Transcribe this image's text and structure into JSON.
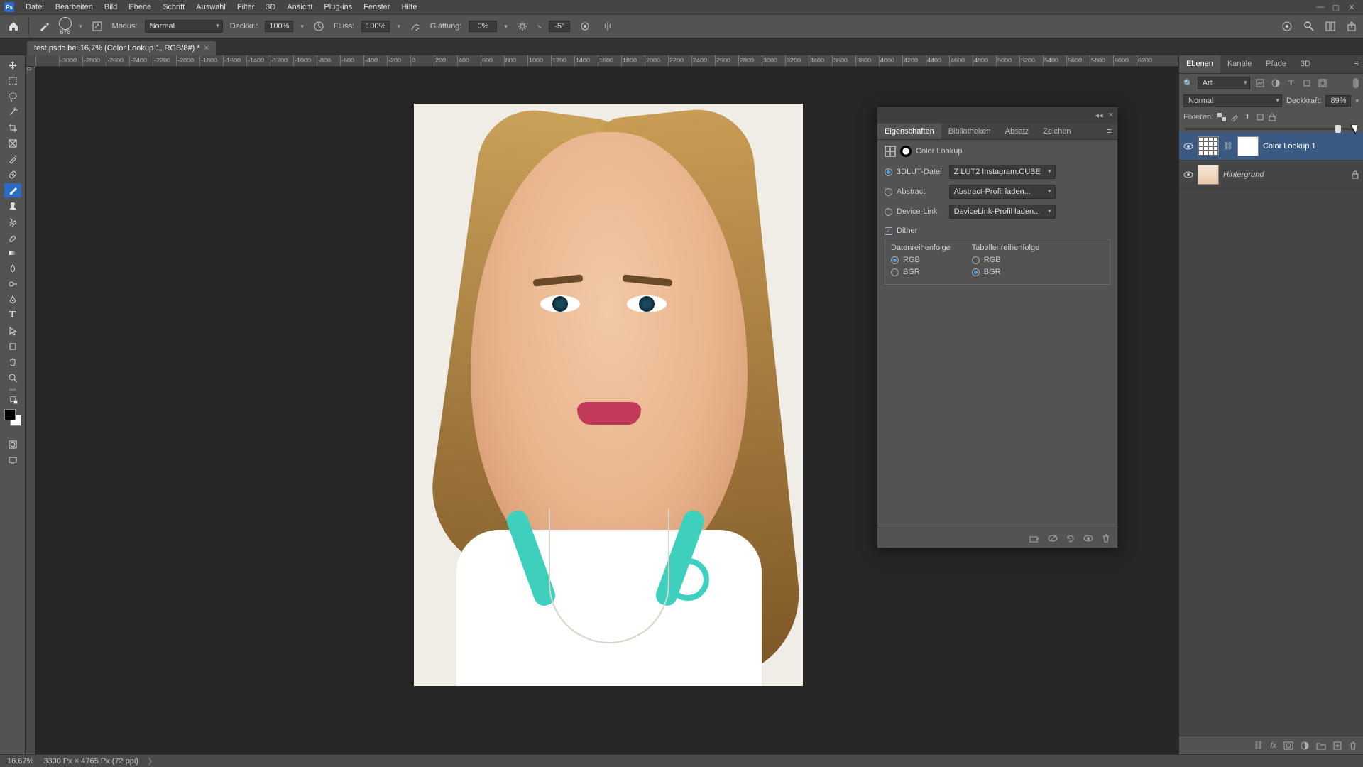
{
  "menu": {
    "items": [
      "Datei",
      "Bearbeiten",
      "Bild",
      "Ebene",
      "Schrift",
      "Auswahl",
      "Filter",
      "3D",
      "Ansicht",
      "Plug-ins",
      "Fenster",
      "Hilfe"
    ]
  },
  "options": {
    "brush_size": "678",
    "modus_label": "Modus:",
    "modus_value": "Normal",
    "deckkr_label": "Deckkr.:",
    "deckkr_value": "100%",
    "fluss_label": "Fluss:",
    "fluss_value": "100%",
    "glatt_label": "Glättung:",
    "glatt_value": "0%",
    "angle_value": "-5°"
  },
  "doc_tab": {
    "title": "test.psdc bei 16,7% (Color Lookup 1, RGB/8#) *"
  },
  "ruler_ticks": [
    "",
    "-3000",
    "-2800",
    "-2600",
    "-2400",
    "-2200",
    "-2000",
    "-1800",
    "-1600",
    "-1400",
    "-1200",
    "-1000",
    "-800",
    "-600",
    "-400",
    "-200",
    "0",
    "200",
    "400",
    "600",
    "800",
    "1000",
    "1200",
    "1400",
    "1600",
    "1800",
    "2000",
    "2200",
    "2400",
    "2600",
    "2800",
    "3000",
    "3200",
    "3400",
    "3600",
    "3800",
    "4000",
    "4200",
    "4400",
    "4600",
    "4800",
    "5000",
    "5200",
    "5400",
    "5600",
    "5800",
    "6000",
    "6200"
  ],
  "props_panel": {
    "tabs": [
      "Eigenschaften",
      "Bibliotheken",
      "Absatz",
      "Zeichen"
    ],
    "title": "Color Lookup",
    "source_3dlut": "3DLUT-Datei",
    "source_abstract": "Abstract",
    "source_devlink": "Device-Link",
    "select_3dlut": "Z LUT2 Instagram.CUBE",
    "select_abstract": "Abstract-Profil laden...",
    "select_devlink": "DeviceLink-Profil laden...",
    "dither": "Dither",
    "data_order": "Datenreihenfolge",
    "table_order": "Tabellenreihenfolge",
    "rgb": "RGB",
    "bgr": "BGR"
  },
  "layers_panel": {
    "tabs": [
      "Ebenen",
      "Kanäle",
      "Pfade",
      "3D"
    ],
    "filter_kind_icon": "🔍",
    "filter_kind": "Art",
    "blend_mode": "Normal",
    "opacity_label": "Deckkraft:",
    "opacity_value": "89%",
    "lock_label": "Fixieren:",
    "layer1": "Color Lookup 1",
    "layer2": "Hintergrund"
  },
  "status": {
    "zoom": "16.67%",
    "dims": "3300 Px × 4765 Px (72 ppi)"
  }
}
